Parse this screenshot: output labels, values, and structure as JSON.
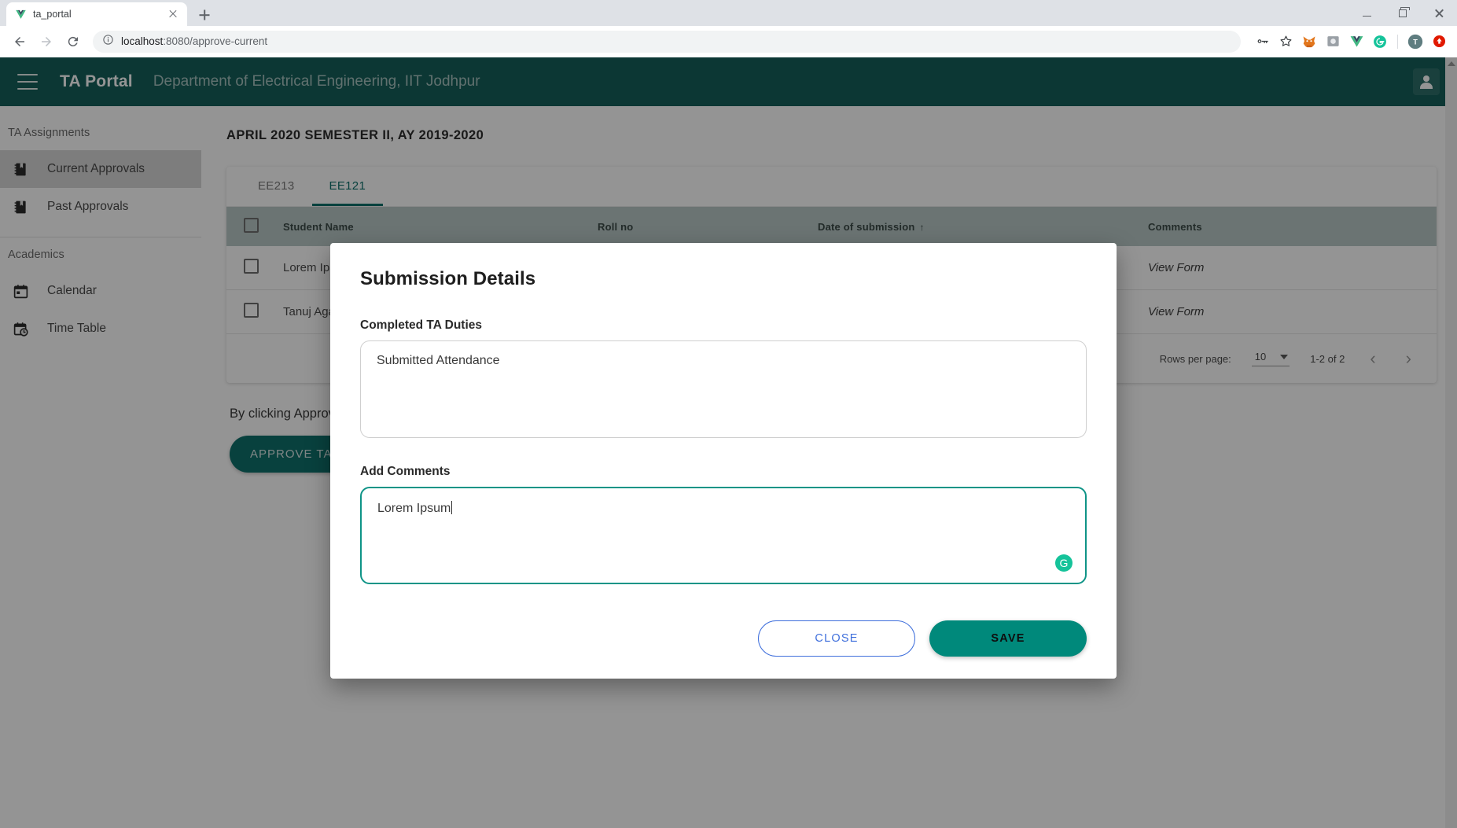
{
  "browser": {
    "tab": {
      "title": "ta_portal",
      "favicon": "vue-logo-icon"
    },
    "new_tab_label": "+",
    "url_host": "localhost",
    "url_rest": ":8080/approve-current",
    "extensions": [
      "key-icon",
      "star-icon",
      "metamask-fox-icon",
      "grayscale-extension-icon",
      "vue-devtools-icon",
      "grammarly-icon",
      "profile-avatar-t",
      "update-available-icon"
    ],
    "profile_initial": "T",
    "window_controls": [
      "minimize",
      "restore",
      "close"
    ]
  },
  "header": {
    "brand": "TA Portal",
    "department": "Department of Electrical Engineering, IIT Jodhpur",
    "menu_icon": "hamburger-menu-icon",
    "avatar_icon": "account-avatar-icon"
  },
  "sidebar": {
    "sections": [
      {
        "label": "TA Assignments",
        "items": [
          {
            "label": "Current Approvals",
            "icon": "notebook-icon",
            "active": true
          },
          {
            "label": "Past Approvals",
            "icon": "notebook-icon",
            "active": false
          }
        ]
      },
      {
        "label": "Academics",
        "items": [
          {
            "label": "Calendar",
            "icon": "calendar-icon",
            "active": false
          },
          {
            "label": "Time Table",
            "icon": "calendar-clock-icon",
            "active": false
          }
        ]
      }
    ]
  },
  "main": {
    "page_title": "APRIL 2020 SEMESTER II, AY 2019-2020",
    "tabs": [
      {
        "label": "EE213",
        "active": false
      },
      {
        "label": "EE121",
        "active": true
      }
    ],
    "table": {
      "columns": [
        "Student Name",
        "Roll no",
        "Date of submission",
        "Comments"
      ],
      "sort_column": "Date of submission",
      "sort_arrow": "↑",
      "rows": [
        {
          "name": "Lorem Ipsum",
          "roll": "",
          "date": "",
          "comments": "View Form"
        },
        {
          "name": "Tanuj Agarwal",
          "roll": "",
          "date": "",
          "comments": "View Form"
        }
      ]
    },
    "pagination": {
      "rows_per_page_label": "Rows per page:",
      "rows_per_page_value": "10",
      "range": "1-2 of 2",
      "prev_icon": "chevron-left-icon",
      "next_icon": "chevron-right-icon"
    },
    "approve_note": "By clicking Approve,",
    "approve_button": "APPROVE TA REL"
  },
  "dialog": {
    "title": "Submission Details",
    "duties_label": "Completed TA Duties",
    "duties_value": "Submitted Attendance",
    "comments_label": "Add Comments",
    "comments_value": "Lorem Ipsum",
    "grammarly_badge": "G",
    "close_label": "CLOSE",
    "save_label": "SAVE"
  },
  "colors": {
    "header_teal": "#15605b",
    "accent_teal": "#0f706b",
    "save_teal": "#00897b",
    "close_blue": "#3f6fdc",
    "table_header": "#b9c8c6",
    "grammarly_green": "#15c39a"
  }
}
